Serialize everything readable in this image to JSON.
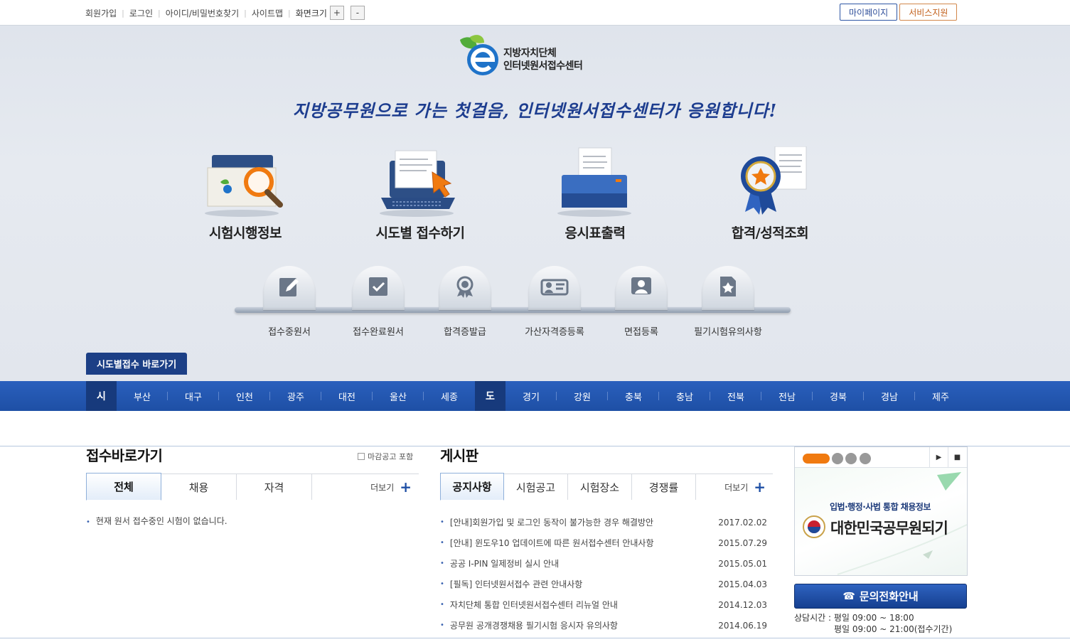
{
  "util_links": [
    "회원가입",
    "로그인",
    "아이디/비밀번호찾기",
    "사이트맵"
  ],
  "zoom": {
    "label": "화면크기",
    "plus": "+",
    "minus": "-"
  },
  "top_buttons": {
    "mypage": "마이페이지",
    "support": "서비스지원"
  },
  "logo": {
    "line1": "지방자치단체",
    "line2": "인터넷원서접수센터"
  },
  "slogan": "지방공무원으로 가는 첫걸음, 인터넷원서접수센터가 응원합니다!",
  "main_menu": [
    {
      "label": "시험시행정보",
      "icon": "magnifier-folder-icon"
    },
    {
      "label": "시도별 접수하기",
      "icon": "laptop-cursor-icon"
    },
    {
      "label": "응시표출력",
      "icon": "printer-icon"
    },
    {
      "label": "합격/성적조회",
      "icon": "award-ribbon-icon"
    }
  ],
  "sub_menu": [
    {
      "label": "접수중원서",
      "icon": "pencil-icon"
    },
    {
      "label": "접수완료원서",
      "icon": "check-icon"
    },
    {
      "label": "합격증발급",
      "icon": "medal-icon"
    },
    {
      "label": "가산자격증등록",
      "icon": "id-card-icon"
    },
    {
      "label": "면접등록",
      "icon": "person-icon"
    },
    {
      "label": "필기시험유의사항",
      "icon": "star-document-icon"
    }
  ],
  "region_tab": "시도별접수 바로가기",
  "regions": {
    "si_label": "시",
    "si": [
      "부산",
      "대구",
      "인천",
      "광주",
      "대전",
      "울산",
      "세종"
    ],
    "do_label": "도",
    "do": [
      "경기",
      "강원",
      "충북",
      "충남",
      "전북",
      "전남",
      "경북",
      "경남",
      "제주"
    ]
  },
  "reception": {
    "title": "접수바로가기",
    "checkbox_label": "마감공고 포함",
    "tabs": [
      "전체",
      "채용",
      "자격"
    ],
    "more": "더보기",
    "empty": "현재 원서 접수중인 시험이 없습니다."
  },
  "board": {
    "title": "게시판",
    "tabs": [
      "공지사항",
      "시험공고",
      "시험장소",
      "경쟁률"
    ],
    "more": "더보기",
    "items": [
      {
        "title": "[안내]회원가입 및 로그인 동작이 불가능한 경우 해결방안",
        "date": "2017.02.02"
      },
      {
        "title": "[안내] 윈도우10 업데이트에 따른 원서접수센터 안내사항",
        "date": "2015.07.29"
      },
      {
        "title": "공공 I-PIN 일제정비 실시 안내",
        "date": "2015.05.01"
      },
      {
        "title": "[필독] 인터넷원서접수 관련 안내사항",
        "date": "2015.04.03"
      },
      {
        "title": "자치단체 통합 인터넷원서접수센터 리뉴얼 안내",
        "date": "2014.12.03"
      },
      {
        "title": "공무원 공개경쟁채용 필기시험 응시자 유의사항",
        "date": "2014.06.19"
      }
    ]
  },
  "banner": {
    "subtitle": "입법·행정·사법 통합 채용정보",
    "title": "대한민국공무원되기",
    "play": "▶",
    "stop": "■"
  },
  "contact": {
    "button": "문의전화안내",
    "hours_line1": "상담시간 : 평일 09:00 ~ 18:00",
    "hours_line2": "평일 09:00 ~ 21:00(접수기간)"
  },
  "colors": {
    "primary": "#1e4fa5",
    "dark_navy": "#1c3f86",
    "accent_orange": "#f07a10"
  }
}
